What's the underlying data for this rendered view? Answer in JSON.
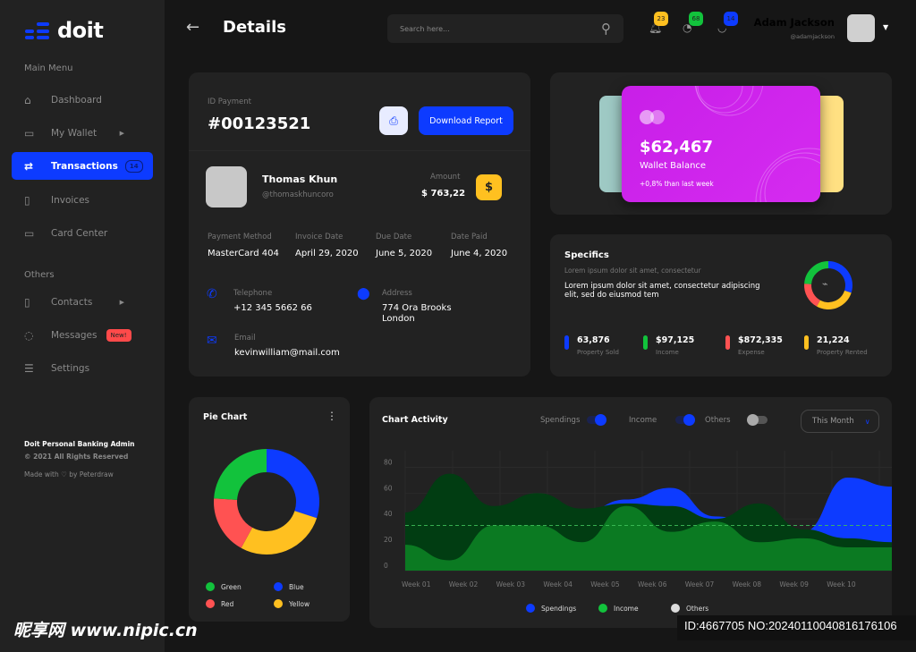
{
  "sidebar": {
    "logo": "doit",
    "main_menu": "Main Menu",
    "others": "Others",
    "items": [
      {
        "label": "Dashboard",
        "icon": "home-icon"
      },
      {
        "label": "My Wallet",
        "icon": "wallet-icon"
      },
      {
        "label": "Transactions",
        "icon": "transfer-icon",
        "badge": "14"
      },
      {
        "label": "Invoices",
        "icon": "invoice-icon"
      },
      {
        "label": "Card Center",
        "icon": "card-icon"
      }
    ],
    "other_items": [
      {
        "label": "Contacts",
        "icon": "contacts-icon"
      },
      {
        "label": "Messages",
        "icon": "message-icon",
        "badge": "New!"
      },
      {
        "label": "Settings",
        "icon": "settings-icon"
      }
    ],
    "footer": {
      "title": "Doit Personal Banking Admin",
      "copyright": "© 2021 All Rights Reserved",
      "made": "Made with ♡ by Peterdraw"
    }
  },
  "header": {
    "title": "Details",
    "search_placeholder": "Search here...",
    "notifications": "23",
    "messages": "68",
    "cart": "14",
    "user_name": "Adam Jackson",
    "user_handle": "@adamjackson"
  },
  "payment": {
    "id_label": "ID Payment",
    "id": "#00123521",
    "download": "Download Report",
    "name": "Thomas Khun",
    "handle": "@thomaskhuncoro",
    "amount_label": "Amount",
    "amount": "$ 763,22",
    "fields": [
      {
        "label": "Payment Method",
        "value": "MasterCard 404"
      },
      {
        "label": "Invoice Date",
        "value": "April 29, 2020"
      },
      {
        "label": "Due Date",
        "value": "June 5, 2020"
      },
      {
        "label": "Date Paid",
        "value": "June 4, 2020"
      }
    ],
    "telephone_label": "Telephone",
    "telephone": "+12 345 5662 66",
    "address_label": "Address",
    "address1": "774 Ora Brooks",
    "address2": "London",
    "email_label": "Email",
    "email": "kevinwilliam@mail.com"
  },
  "wallet": {
    "balance": "$62,467",
    "label": "Wallet Balance",
    "change": "+0,8% than last week"
  },
  "specifics": {
    "title": "Specifics",
    "subtitle": "Lorem ipsum dolor sit amet, consectetur",
    "text": "Lorem ipsum dolor sit amet, consectetur adipiscing elit, sed do eiusmod tem",
    "stats": [
      {
        "value": "63,876",
        "label": "Property Sold",
        "color": "#0d3bff"
      },
      {
        "value": "$97,125",
        "label": "Income",
        "color": "#12c23c"
      },
      {
        "value": "$872,335",
        "label": "Expense",
        "color": "#ff5252"
      },
      {
        "value": "21,224",
        "label": "Property Rented",
        "color": "#ffc020"
      }
    ]
  },
  "chart_data": [
    {
      "type": "pie",
      "title": "Pie Chart",
      "categories": [
        "Blue",
        "Yellow",
        "Red",
        "Green"
      ],
      "values": [
        30,
        28,
        18,
        24
      ],
      "colors": [
        "#0d3bff",
        "#ffc020",
        "#ff5252",
        "#12c23c"
      ],
      "legend": [
        "Green",
        "Blue",
        "Red",
        "Yellow"
      ],
      "legend_placement": "bottom"
    },
    {
      "type": "area",
      "title": "Chart Activity",
      "toggles": [
        {
          "label": "Spendings",
          "on": true
        },
        {
          "label": "Income",
          "on": true
        },
        {
          "label": "Others",
          "on": false
        }
      ],
      "period": "This Month",
      "categories": [
        "Week 01",
        "Week 02",
        "Week 03",
        "Week 04",
        "Week 05",
        "Week 06",
        "Week 07",
        "Week 08",
        "Week 09",
        "Week 10"
      ],
      "yticks": [
        "0",
        "20",
        "40",
        "60",
        "80"
      ],
      "ylim": [
        0,
        90
      ],
      "reference_line": 35,
      "grid": true,
      "series": [
        {
          "name": "Spendings",
          "color": "#0d3bff",
          "values": [
            20,
            20,
            20,
            30,
            45,
            55,
            64,
            42,
            36,
            30,
            72,
            65
          ]
        },
        {
          "color": "#013d12",
          "values": [
            45,
            75,
            50,
            60,
            48,
            52,
            50,
            40,
            52,
            32,
            25,
            22
          ]
        },
        {
          "name": "Income",
          "color": "#0b7a22",
          "values": [
            20,
            8,
            35,
            35,
            22,
            50,
            30,
            38,
            22,
            25,
            18,
            18
          ]
        }
      ],
      "legend": [
        {
          "label": "Spendings",
          "color": "#0d3bff"
        },
        {
          "label": "Income",
          "color": "#12c23c"
        },
        {
          "label": "Others",
          "color": "#dddddd"
        }
      ],
      "legend_placement": "bottom"
    }
  ],
  "watermark": {
    "site": "昵享网 www.nipic.cn",
    "id": "ID:4667705 NO:20240110040816176106"
  }
}
